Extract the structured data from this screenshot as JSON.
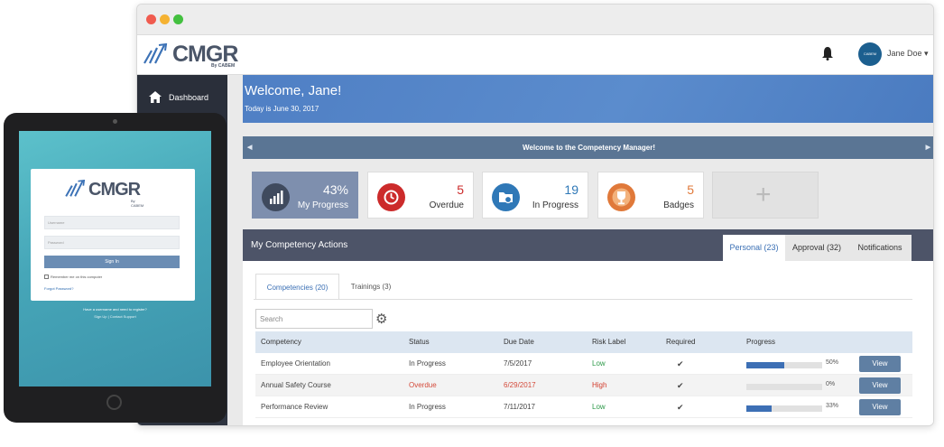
{
  "app": {
    "logo_text": "CMGR",
    "logo_sub": "By CABEM"
  },
  "topbar": {
    "user_name": "Jane Doe",
    "avatar_text": "CABEM"
  },
  "sidebar": {
    "items": [
      {
        "label": "Dashboard",
        "icon": "home-icon"
      }
    ]
  },
  "welcome": {
    "heading": "Welcome, Jane!",
    "date_text": "Today is June 30, 2017"
  },
  "banner": {
    "text": "Welcome to the Competency Manager!"
  },
  "cards": [
    {
      "value": "43%",
      "label": "My Progress",
      "icon": "chart-bars-icon",
      "color": "#7e8fae"
    },
    {
      "value": "5",
      "label": "Overdue",
      "icon": "clock-icon",
      "color": "#cc2b2b"
    },
    {
      "value": "19",
      "label": "In Progress",
      "icon": "folder-refresh-icon",
      "color": "#2f78b7"
    },
    {
      "value": "5",
      "label": "Badges",
      "icon": "trophy-icon",
      "color": "#e0793a"
    }
  ],
  "actions": {
    "title": "My Competency Actions",
    "tabs": [
      "Personal (23)",
      "Approval (32)",
      "Notifications"
    ]
  },
  "subtabs": [
    "Competencies (20)",
    "Trainings (3)"
  ],
  "search": {
    "placeholder": "Search"
  },
  "table": {
    "headers": [
      "Competency",
      "Status",
      "Due Date",
      "Risk Label",
      "Required",
      "Progress"
    ],
    "rows": [
      {
        "name": "Employee Orientation",
        "status": "In Progress",
        "due": "7/5/2017",
        "risk": "Low",
        "required": "✔",
        "progress": 50,
        "pct_text": "50%",
        "action": "View"
      },
      {
        "name": "Annual Safety Course",
        "status": "Overdue",
        "due": "6/29/2017",
        "risk": "High",
        "required": "✔",
        "progress": 0,
        "pct_text": "0%",
        "action": "View"
      },
      {
        "name": "Performance Review",
        "status": "In Progress",
        "due": "7/11/2017",
        "risk": "Low",
        "required": "✔",
        "progress": 33,
        "pct_text": "33%",
        "action": "View"
      }
    ]
  },
  "tablet": {
    "logo_text": "CMGR",
    "logo_sub": "By CABEM",
    "username_placeholder": "Username",
    "password_placeholder": "Password",
    "signin_label": "Sign In",
    "remember_label": "Remember me on this computer",
    "forgot_label": "Forgot Password?",
    "register_text": "Have a username and need to register?",
    "links_text": "Sign Up | Contact Support"
  },
  "colors": {
    "risk_low": "#2e9a4a",
    "risk_high": "#d23b2b",
    "overdue": "#d44a3a",
    "accent": "#3a6fb4"
  }
}
